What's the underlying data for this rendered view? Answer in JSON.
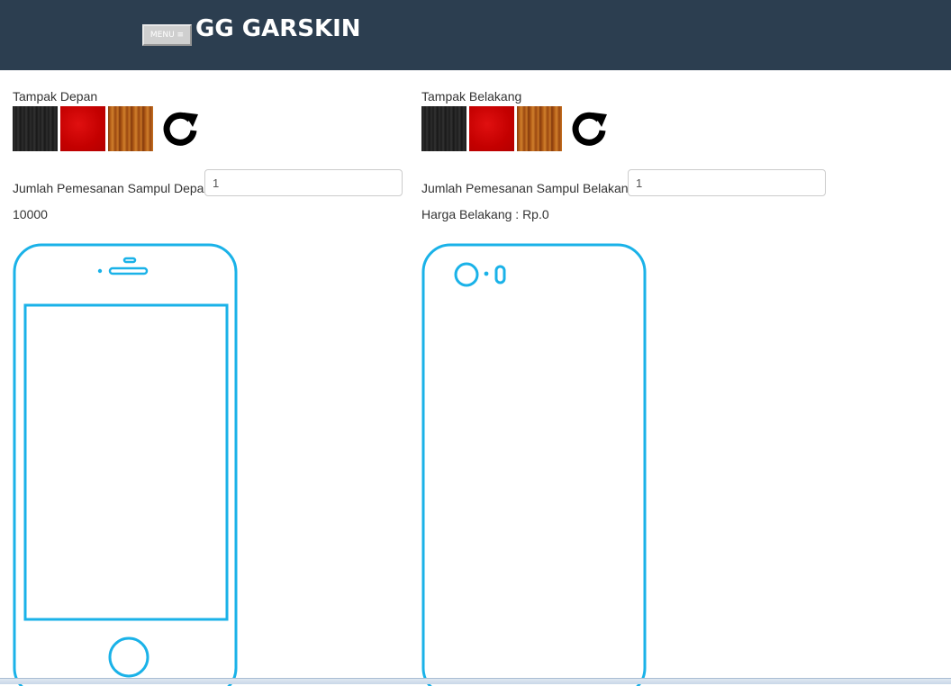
{
  "header": {
    "menu_label": "MENU ≡",
    "brand": "GG GARSKIN",
    "background": "#2c3e50"
  },
  "front": {
    "view_label": "Tampak Depan",
    "swatches": [
      "black-texture",
      "red-texture",
      "wood-texture"
    ],
    "rotate_icon": "rotate-icon",
    "qty_label": "Jumlah Pemesanan Sampul Depan",
    "qty_value": "1",
    "price_text": "10000"
  },
  "back": {
    "view_label": "Tampak Belakang",
    "swatches": [
      "black-texture",
      "red-texture",
      "wood-texture"
    ],
    "rotate_icon": "rotate-icon",
    "qty_label": "Jumlah Pemesanan Sampul Belakang",
    "qty_value": "1",
    "price_text": "Harga Belakang : Rp.0"
  },
  "colors": {
    "phone_outline": "#1ab2e8",
    "text": "#333333"
  }
}
